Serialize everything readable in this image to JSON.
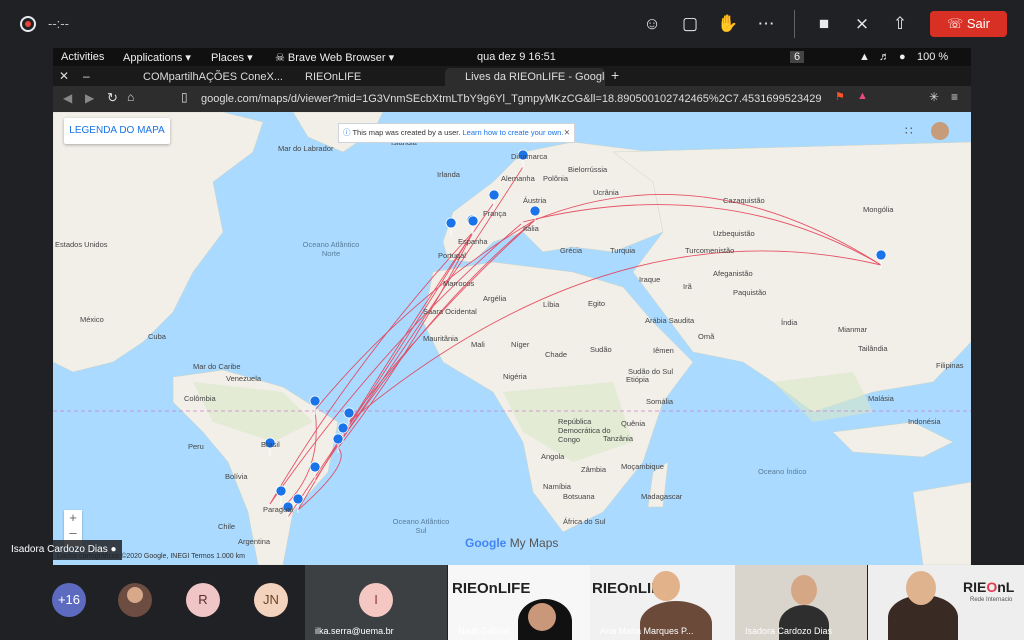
{
  "meet": {
    "timer": "--:--",
    "leave_label": "Sair",
    "icons": [
      "people-icon",
      "chat-icon",
      "raise-hand-icon",
      "more-options-icon",
      "camera-icon",
      "mic-muted-icon",
      "present-screen-icon"
    ],
    "presenter_name": "Isadora Cardozo Dias",
    "participants_overflow": "+16",
    "avatars": [
      "R",
      "JN",
      "I"
    ],
    "ilka_label": "ilka.serra@uema.br",
    "tiles": [
      {
        "name": "Naidi Gabriel"
      },
      {
        "name": "Ana Maria Marques P..."
      },
      {
        "name": "Isadora Cardozo Dias"
      },
      {
        "name": ""
      }
    ],
    "rieonlife_logo": "RIEOnLIFE",
    "rede_text": "Rede Internacio"
  },
  "desktop": {
    "activities": "Activities",
    "applications": "Applications",
    "places": "Places",
    "browser": "Brave Web Browser",
    "clock": "qua dez 9   16:51",
    "workspace": "6",
    "battery": "100 %"
  },
  "browser": {
    "tabs": [
      {
        "label": "COMpartilhAÇÕES ConeX..."
      },
      {
        "label": "RIEOnLIFE"
      },
      {
        "label": "Lives da RIEOnLIFE - Google"
      }
    ],
    "url": "google.com/maps/d/viewer?mid=1G3VnmSEcbXtmLTbY9g6Yl_TgmpyMKzCG&ll=18.890500102742465%2C7.45316995234290..."
  },
  "map": {
    "legend_button": "LEGENDA DO MAPA",
    "notice": "This map was created by a user.",
    "notice_link": "Learn how to create your own.",
    "labels": [
      "Mar do Labrador",
      "Islândia",
      "Irlanda",
      "Dinamarca",
      "Alemanha",
      "Polônia",
      "Bielorrússia",
      "Ucrânia",
      "França",
      "Áustria",
      "Itália",
      "Espanha",
      "Portugal",
      "Grécia",
      "Turquia",
      "Cazaquistão",
      "Mongólia",
      "Uzbequistão",
      "Turcomenistão",
      "Afeganistão",
      "Paquistão",
      "Irã",
      "Iraque",
      "Índia",
      "Mianmar",
      "Tailândia",
      "Filipinas",
      "Malásia",
      "Indonésia",
      "Estados Unidos",
      "México",
      "Cuba",
      "Venezuela",
      "Colômbia",
      "Peru",
      "Brasil",
      "Bolívia",
      "Chile",
      "Argentina",
      "Paraguai",
      "Marrocos",
      "Argélia",
      "Líbia",
      "Egito",
      "Saara Ocidental",
      "Mauritânia",
      "Mali",
      "Níger",
      "Chade",
      "Sudão",
      "Nigéria",
      "Etiópia",
      "Somália",
      "Quênia",
      "Tanzânia",
      "Angola",
      "Namíbia",
      "Moçambique",
      "Madagascar",
      "África do Sul",
      "Botsuana",
      "Zâmbia",
      "Sudão do Sul",
      "Iêmen",
      "Omã",
      "Arábia Saudita",
      "República Democrática do Congo",
      "Mar do Caribe"
    ],
    "oceans": [
      "Oceano Atlântico Norte",
      "Oceano Índico",
      "Oceano Atlântico Sul"
    ],
    "footer": "Dados cartográficos ©2020 Google, INEGI   Termos   1.000 km",
    "google": "Google",
    "my_maps": "My Maps",
    "pin_color": "#1a73e8",
    "route_color": "#e53950"
  }
}
